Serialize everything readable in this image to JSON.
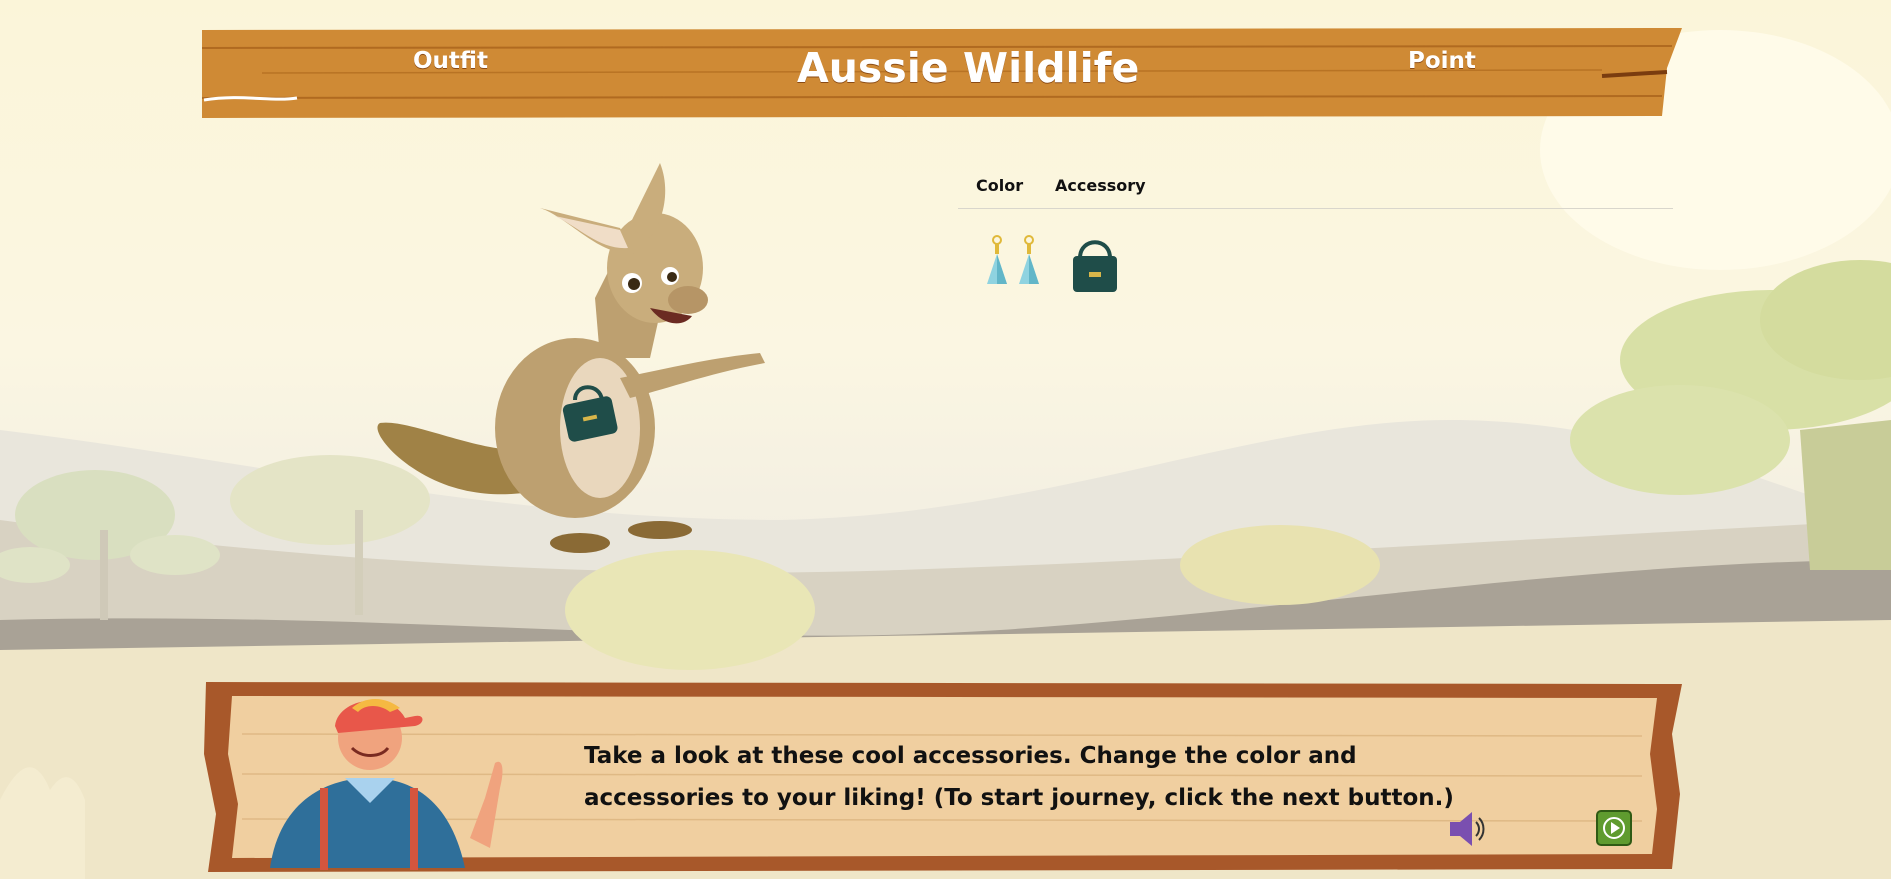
{
  "header": {
    "outfit_label": "Outfit",
    "title": "Aussie Wildlife",
    "point_label": "Point"
  },
  "tabs": [
    {
      "label": "Color"
    },
    {
      "label": "Accessory"
    }
  ],
  "accessories": [
    {
      "name": "earrings-icon"
    },
    {
      "name": "handbag-icon"
    }
  ],
  "dialog": {
    "message": "Take a look at these cool accessories. Change the color and accessories to your liking! (To start journey, click the next button.)"
  },
  "colors": {
    "wood": "#cf8a35",
    "board": "#f0cfa0",
    "bag": "#1f4d49",
    "sound": "#7a4fb0",
    "next": "#5f9b2f"
  }
}
